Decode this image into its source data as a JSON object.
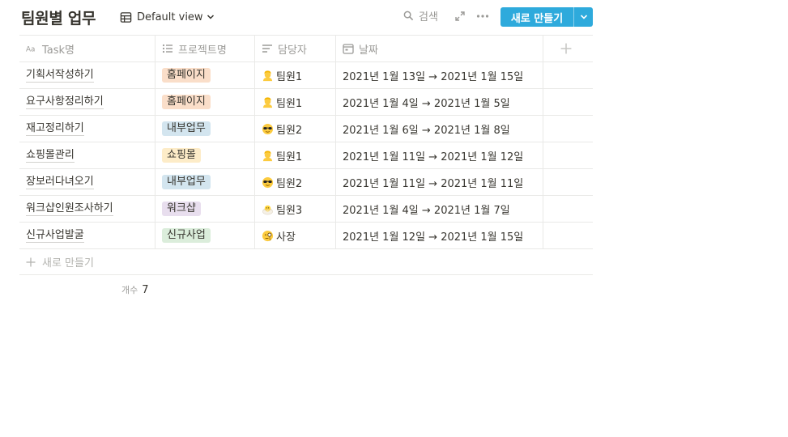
{
  "page": {
    "title": "팀원별 업무"
  },
  "view": {
    "label": "Default view"
  },
  "toolbar": {
    "search_label": "검색",
    "new_label": "새로 만들기"
  },
  "colors": {
    "accent": "#2eaadc",
    "tag_homepage": "#fadec9",
    "tag_internal": "#d3e5ef",
    "tag_shopping": "#fdecc8",
    "tag_workshop": "#e8deee",
    "tag_newbiz": "#dbeddb"
  },
  "table": {
    "columns": [
      {
        "label": "Task명",
        "icon": "text-icon"
      },
      {
        "label": "프로젝트명",
        "icon": "list-icon"
      },
      {
        "label": "담당자",
        "icon": "select-icon"
      },
      {
        "label": "날짜",
        "icon": "calendar-icon"
      }
    ],
    "rows": [
      {
        "task": "기획서작성하기",
        "project": "홈페이지",
        "owner": "팀원1",
        "owner_icon": "person-yellow-icon",
        "date": "2021년 1월 13일 → 2021년 1월 15일"
      },
      {
        "task": "요구사항정리하기",
        "project": "홈페이지",
        "owner": "팀원1",
        "owner_icon": "person-yellow-icon",
        "date": "2021년 1월 4일 → 2021년 1월 5일"
      },
      {
        "task": "재고정리하기",
        "project": "내부업무",
        "owner": "팀원2",
        "owner_icon": "sunglasses-face-icon",
        "date": "2021년 1월 6일 → 2021년 1월 8일"
      },
      {
        "task": "쇼핑몰관리",
        "project": "쇼핑몰",
        "owner": "팀원1",
        "owner_icon": "person-yellow-icon",
        "date": "2021년 1월 11일 → 2021년 1월 12일"
      },
      {
        "task": "장보러다녀오기",
        "project": "내부업무",
        "owner": "팀원2",
        "owner_icon": "sunglasses-face-icon",
        "date": "2021년 1월 11일 → 2021년 1월 11일"
      },
      {
        "task": "워크샵인원조사하기",
        "project": "워크샵",
        "owner": "팀원3",
        "owner_icon": "hatching-chick-icon",
        "date": "2021년 1월 4일 → 2021년 1월 7일"
      },
      {
        "task": "신규사업발굴",
        "project": "신규사업",
        "owner": "사장",
        "owner_icon": "monocle-face-icon",
        "date": "2021년 1월 12일 → 2021년 1월 15일"
      }
    ],
    "new_row_label": "새로 만들기"
  },
  "footer": {
    "count_label": "개수",
    "count_value": "7"
  }
}
